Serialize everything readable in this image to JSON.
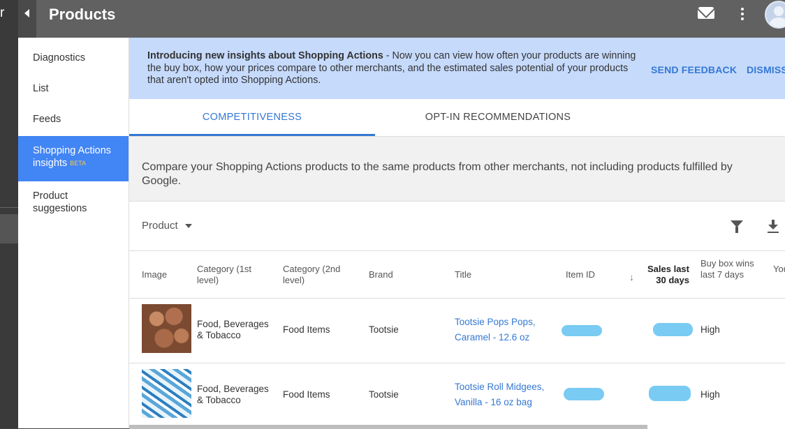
{
  "rail": {
    "glyph": "r"
  },
  "header": {
    "title": "Products"
  },
  "sidebar": {
    "items": [
      {
        "label": "Diagnostics"
      },
      {
        "label": "List"
      },
      {
        "label": "Feeds"
      },
      {
        "label": "Shopping Actions insights",
        "line1": "Shopping Actions",
        "line2": "insights",
        "badge": "BETA"
      },
      {
        "label": "Product suggestions",
        "line1": "Product",
        "line2": "suggestions"
      }
    ]
  },
  "banner": {
    "bold": "Introducing new insights about Shopping Actions",
    "text": " - Now you can view how often your products are winning the buy box, how your prices compare to other merchants, and the estimated sales potential of your products that aren't opted into Shopping Actions.",
    "send_feedback": "SEND FEEDBACK",
    "dismiss": "DISMISS"
  },
  "tabs": [
    {
      "label": "COMPETITIVENESS"
    },
    {
      "label": "OPT-IN RECOMMENDATIONS"
    }
  ],
  "description": "Compare your Shopping Actions products to the same products from other merchants, not including products fulfilled by Google.",
  "toolbar": {
    "product_label": "Product"
  },
  "table": {
    "headers": {
      "image": "Image",
      "cat1": "Category (1st level)",
      "cat2": "Category (2nd level)",
      "brand": "Brand",
      "title": "Title",
      "item_id": "Item ID",
      "sales": "Sales last 30 days",
      "buybox": "Buy box wins last 7 days",
      "extra": "You"
    },
    "rows": [
      {
        "cat1": "Food, Beverages & Tobacco",
        "cat2": "Food Items",
        "brand": "Tootsie",
        "title": "Tootsie Pops Pops, Caramel - 12.6 oz",
        "buybox": "High"
      },
      {
        "cat1": "Food, Beverages & Tobacco",
        "cat2": "Food Items",
        "brand": "Tootsie",
        "title": "Tootsie Roll Midgees, Vanilla - 16 oz bag",
        "buybox": "High"
      }
    ]
  },
  "colors": {
    "accent": "#3478d4",
    "banner": "#c6dafc",
    "active_nav": "#4285f4"
  }
}
